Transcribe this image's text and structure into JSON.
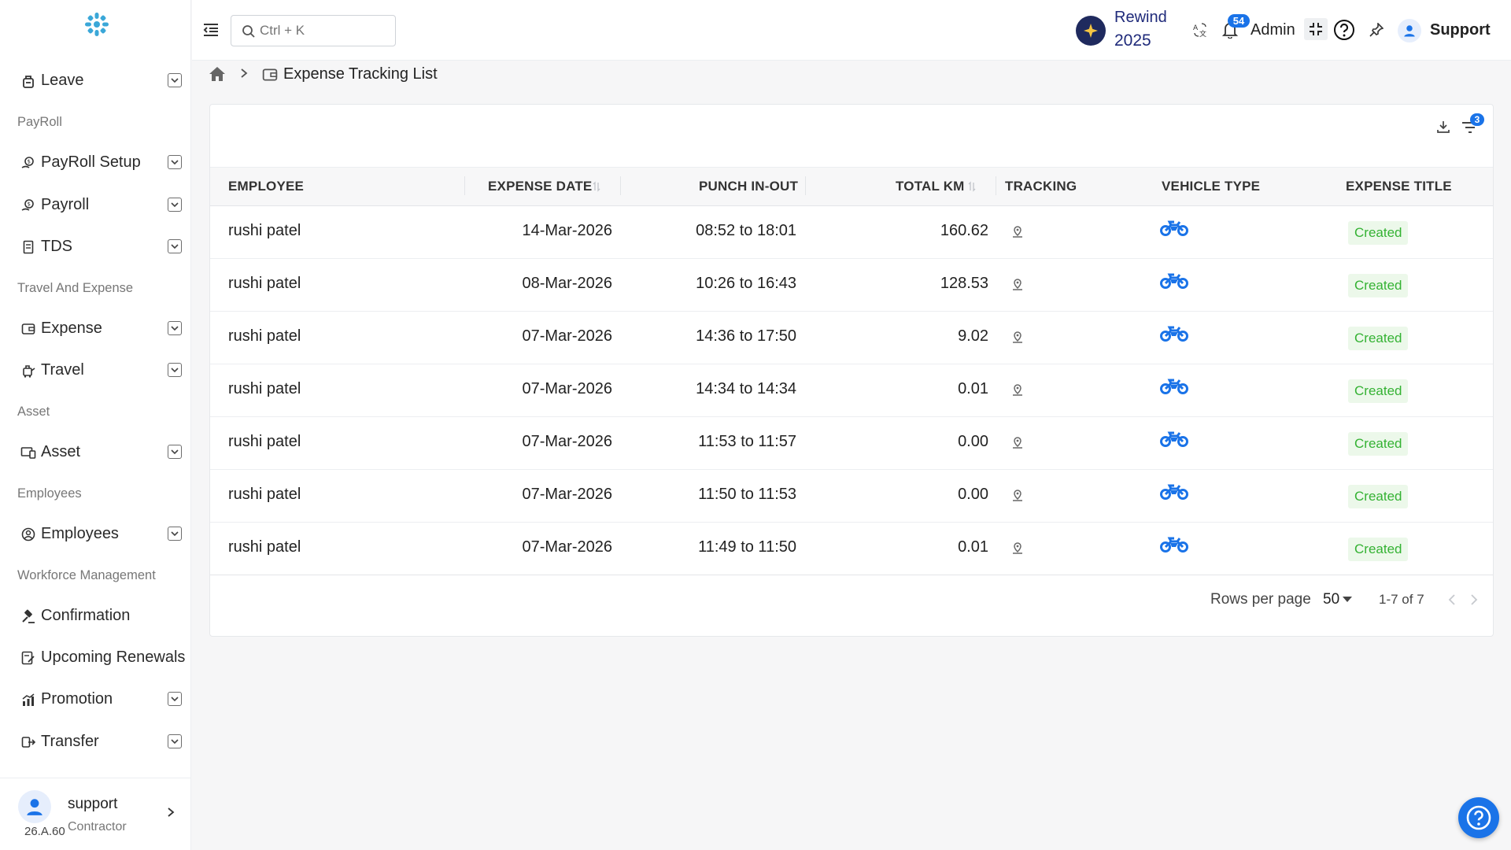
{
  "app": {
    "search_placeholder": "Ctrl + K"
  },
  "header": {
    "rewind_line1": "Rewind",
    "rewind_line2": "2025",
    "notification_count": "54",
    "role_label": "Admin",
    "user_label": "Support"
  },
  "sidebar": {
    "items": [
      {
        "label": "Leave"
      },
      {
        "label": "PayRoll Setup"
      },
      {
        "label": "Payroll"
      },
      {
        "label": "TDS"
      },
      {
        "label": "Expense"
      },
      {
        "label": "Travel"
      },
      {
        "label": "Asset"
      },
      {
        "label": "Employees"
      },
      {
        "label": "Confirmation"
      },
      {
        "label": "Upcoming Renewals"
      },
      {
        "label": "Promotion"
      },
      {
        "label": "Transfer"
      }
    ],
    "sections": [
      "PayRoll",
      "Travel And Expense",
      "Asset",
      "Employees",
      "Workforce Management"
    ],
    "footer": {
      "name": "support",
      "role": "Contractor",
      "version": "26.A.60"
    }
  },
  "breadcrumb": {
    "title": "Expense Tracking List"
  },
  "toolbar": {
    "filter_count": "3"
  },
  "table": {
    "columns": [
      "EMPLOYEE",
      "EXPENSE DATE",
      "PUNCH IN-OUT",
      "TOTAL KM",
      "TRACKING",
      "VEHICLE TYPE",
      "EXPENSE TITLE"
    ],
    "rows": [
      {
        "employee": "rushi patel",
        "date": "14-Mar-2026",
        "punch": "08:52 to 18:01",
        "km": "160.62",
        "vehicle": "bike-icon",
        "title": "Created"
      },
      {
        "employee": "rushi patel",
        "date": "08-Mar-2026",
        "punch": "10:26 to 16:43",
        "km": "128.53",
        "vehicle": "bike-icon",
        "title": "Created"
      },
      {
        "employee": "rushi patel",
        "date": "07-Mar-2026",
        "punch": "14:36 to 17:50",
        "km": "9.02",
        "vehicle": "bike-icon",
        "title": "Created"
      },
      {
        "employee": "rushi patel",
        "date": "07-Mar-2026",
        "punch": "14:34 to 14:34",
        "km": "0.01",
        "vehicle": "bike-icon",
        "title": "Created"
      },
      {
        "employee": "rushi patel",
        "date": "07-Mar-2026",
        "punch": "11:53 to 11:57",
        "km": "0.00",
        "vehicle": "bike-icon",
        "title": "Created"
      },
      {
        "employee": "rushi patel",
        "date": "07-Mar-2026",
        "punch": "11:50 to 11:53",
        "km": "0.00",
        "vehicle": "bike-icon",
        "title": "Created"
      },
      {
        "employee": "rushi patel",
        "date": "07-Mar-2026",
        "punch": "11:49 to 11:50",
        "km": "0.01",
        "vehicle": "bike-icon",
        "title": "Created"
      }
    ]
  },
  "pagination": {
    "rows_per_page_label": "Rows per page",
    "rows_per_page": "50",
    "range": "1-7 of 7"
  },
  "colors": {
    "accent": "#1a73e8",
    "status_bg": "#ecf8ea",
    "status_text": "#34b233",
    "brand_dark": "#1f2a5e"
  }
}
